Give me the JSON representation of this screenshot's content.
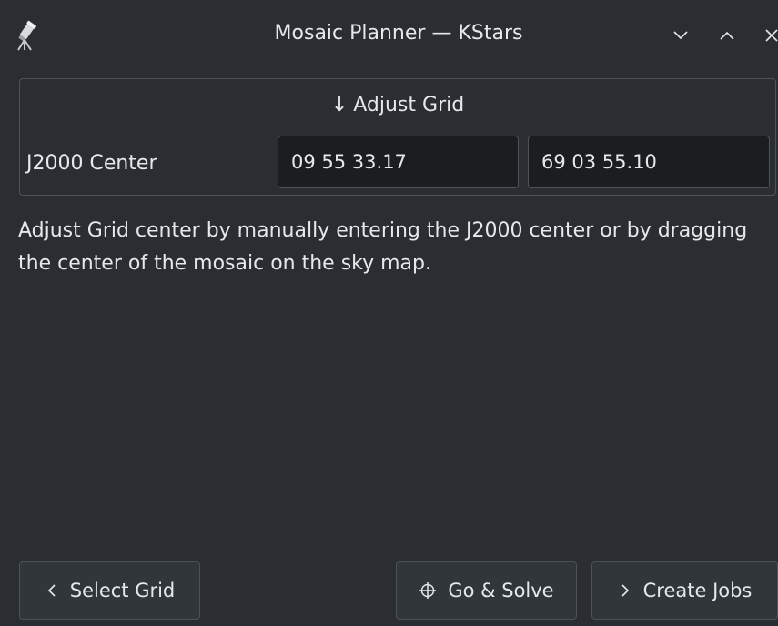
{
  "window": {
    "title": "Mosaic Planner — KStars",
    "app_icon": "telescope-icon",
    "controls": [
      "minimize-icon",
      "maximize-icon",
      "close-icon"
    ]
  },
  "adjust_grid": {
    "header_arrow": "↓",
    "header_label": "Adjust Grid",
    "center_label": "J2000 Center",
    "ra_value": "09 55 33.17",
    "dec_value": "69 03 55.10"
  },
  "description": "Adjust Grid center by manually entering the J2000 center or by dragging the center of the mosaic on the sky map.",
  "buttons": {
    "select_grid": {
      "icon": "chevron-left-icon",
      "label": "Select Grid"
    },
    "go_solve": {
      "icon": "crosshair-icon",
      "label": "Go & Solve"
    },
    "create_jobs": {
      "icon": "chevron-right-icon",
      "label": "Create Jobs"
    }
  },
  "colors": {
    "background": "#2a2e32",
    "input_background": "#1b1e20",
    "button_background": "#31363b",
    "border": "#4d5257",
    "text": "#e6e8ea"
  }
}
